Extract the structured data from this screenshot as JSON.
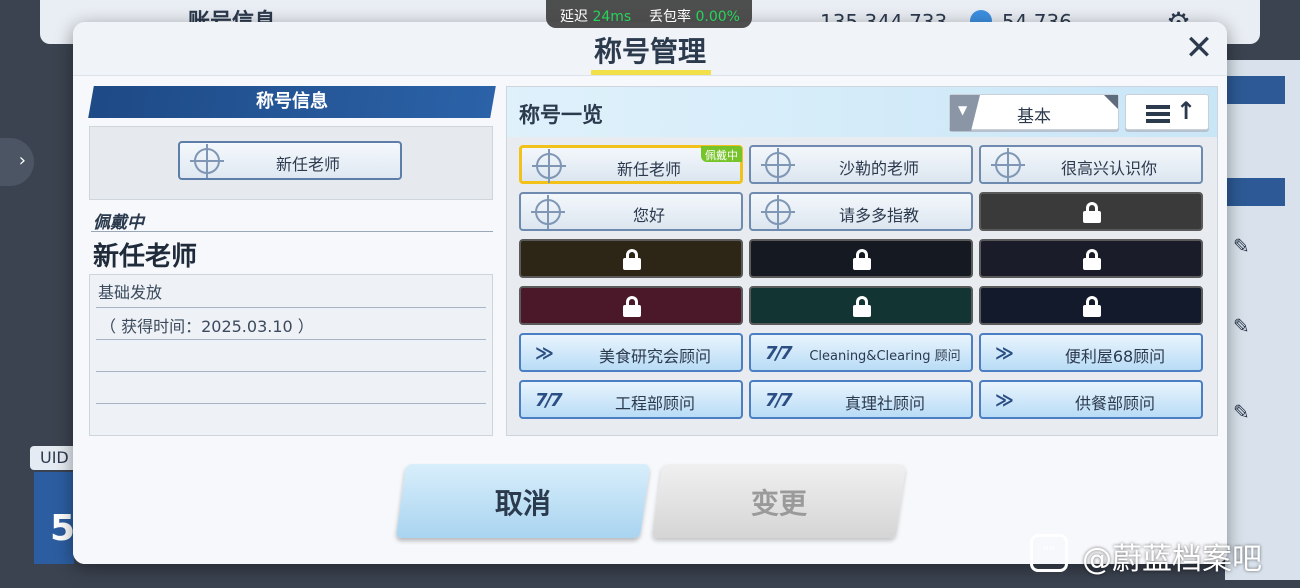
{
  "background": {
    "account_title": "账号信息",
    "credits": "135,344,733",
    "gems": "54,736",
    "uid_label": "UID",
    "level_digit": "5"
  },
  "network": {
    "latency_label": "延迟",
    "latency_value": "24ms",
    "loss_label": "丢包率",
    "loss_value": "0.00%"
  },
  "modal": {
    "title": "称号管理",
    "close_icon": "close-icon"
  },
  "left": {
    "header": "称号信息",
    "preview_title": "新任老师",
    "equipped_label": "佩戴中",
    "equipped_name": "新任老师",
    "detail_heading": "基础发放",
    "detail_text": "（ 获得时间：2025.03.10 ）"
  },
  "right": {
    "header": "称号一览",
    "filter_label": "基本",
    "sort_icon": "sort-ascending-icon",
    "equipped_tag": "佩戴中",
    "titles": [
      {
        "label": "新任老师",
        "state": "selected"
      },
      {
        "label": "沙勒的老师",
        "state": "normal"
      },
      {
        "label": "很高兴认识你",
        "state": "normal"
      },
      {
        "label": "您好",
        "state": "normal"
      },
      {
        "label": "请多多指教",
        "state": "normal"
      },
      {
        "label": "",
        "state": "locked",
        "color": "#3a3a3a"
      },
      {
        "label": "",
        "state": "locked",
        "color": "#2d2616"
      },
      {
        "label": "",
        "state": "locked",
        "color": "#151a22"
      },
      {
        "label": "",
        "state": "locked",
        "color": "#1a1c2a"
      },
      {
        "label": "",
        "state": "locked",
        "color": "#4a1828"
      },
      {
        "label": "",
        "state": "locked",
        "color": "#123432"
      },
      {
        "label": "",
        "state": "locked",
        "color": "#121a2c"
      },
      {
        "label": "美食研究会顾问",
        "state": "blue",
        "logo": "≫"
      },
      {
        "label": "Cleaning&Clearing 顾问",
        "state": "blue",
        "logo": "7/7"
      },
      {
        "label": "便利屋68顾问",
        "state": "blue",
        "logo": "≫"
      },
      {
        "label": "工程部顾问",
        "state": "blue",
        "logo": "7/7"
      },
      {
        "label": "真理社顾问",
        "state": "blue",
        "logo": "7/7"
      },
      {
        "label": "供餐部顾问",
        "state": "blue",
        "logo": "≫"
      }
    ]
  },
  "buttons": {
    "cancel": "取消",
    "change": "变更"
  },
  "watermark": {
    "text": "@蔚蓝档案吧"
  }
}
